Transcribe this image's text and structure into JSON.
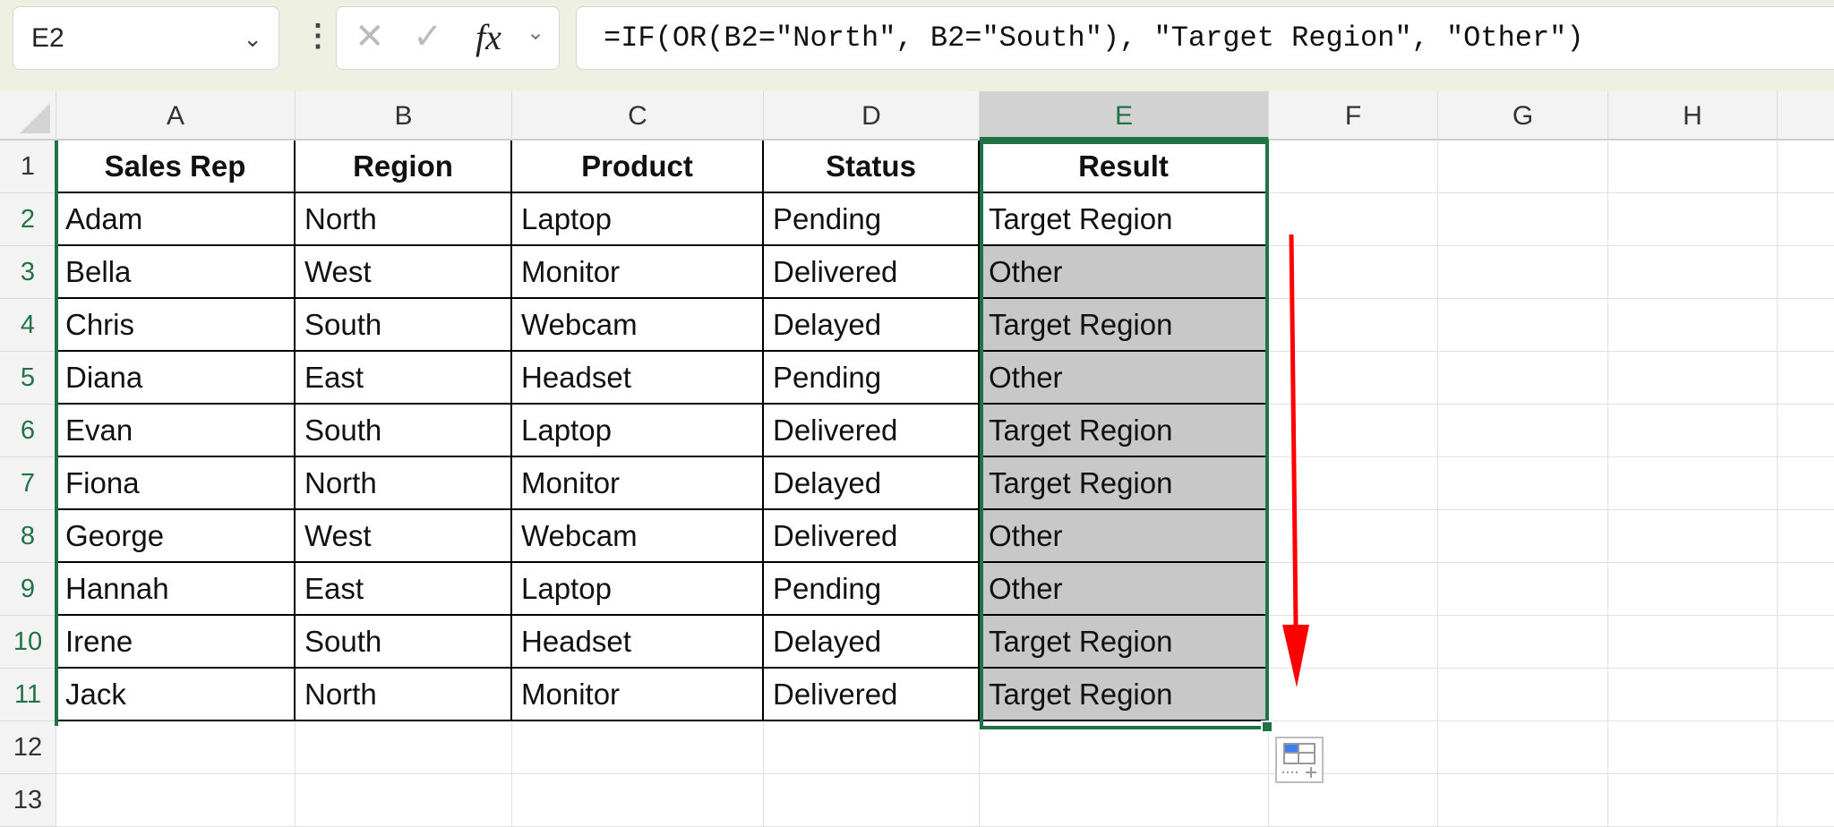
{
  "formula_bar": {
    "name_box": "E2",
    "formula": "=IF(OR(B2=\"North\", B2=\"South\"), \"Target Region\", \"Other\")",
    "cancel_icon": "✕",
    "enter_icon": "✓",
    "fx_label": "fx"
  },
  "columns": [
    "A",
    "B",
    "C",
    "D",
    "E",
    "F",
    "G",
    "H"
  ],
  "rows": [
    "1",
    "2",
    "3",
    "4",
    "5",
    "6",
    "7",
    "8",
    "9",
    "10",
    "11",
    "12",
    "13"
  ],
  "table": {
    "headers": [
      "Sales Rep",
      "Region",
      "Product",
      "Status",
      "Result"
    ],
    "rows": [
      [
        "Adam",
        "North",
        "Laptop",
        "Pending",
        "Target Region"
      ],
      [
        "Bella",
        "West",
        "Monitor",
        "Delivered",
        "Other"
      ],
      [
        "Chris",
        "South",
        "Webcam",
        "Delayed",
        "Target Region"
      ],
      [
        "Diana",
        "East",
        "Headset",
        "Pending",
        "Other"
      ],
      [
        "Evan",
        "South",
        "Laptop",
        "Delivered",
        "Target Region"
      ],
      [
        "Fiona",
        "North",
        "Monitor",
        "Delayed",
        "Target Region"
      ],
      [
        "George",
        "West",
        "Webcam",
        "Delivered",
        "Other"
      ],
      [
        "Hannah",
        "East",
        "Laptop",
        "Pending",
        "Other"
      ],
      [
        "Irene",
        "South",
        "Headset",
        "Delayed",
        "Target Region"
      ],
      [
        "Jack",
        "North",
        "Monitor",
        "Delivered",
        "Target Region"
      ]
    ]
  },
  "colors": {
    "accent": "#217346",
    "arrow": "#ff0000",
    "selected_fill": "#c8c8c8"
  }
}
